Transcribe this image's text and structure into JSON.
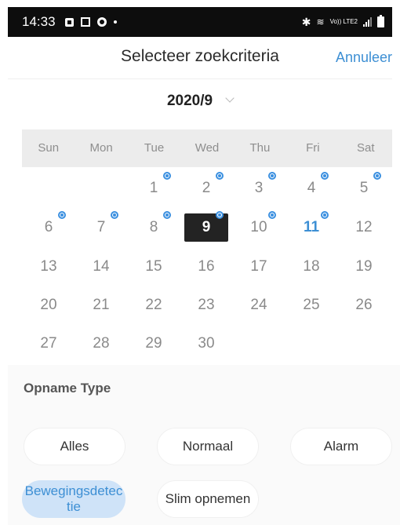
{
  "status_bar": {
    "time": "14:33",
    "lte_label": "Vo)) LTE2"
  },
  "header": {
    "title": "Selecteer zoekcriteria",
    "cancel_label": "Annuleer"
  },
  "calendar": {
    "month_label": "2020/9",
    "weekdays": [
      "Sun",
      "Mon",
      "Tue",
      "Wed",
      "Thu",
      "Fri",
      "Sat"
    ],
    "weeks": [
      [
        "",
        "",
        "1",
        "2",
        "3",
        "4",
        "5"
      ],
      [
        "6",
        "7",
        "8",
        "9",
        "10",
        "11",
        "12"
      ],
      [
        "13",
        "14",
        "15",
        "16",
        "17",
        "18",
        "19"
      ],
      [
        "20",
        "21",
        "22",
        "23",
        "24",
        "25",
        "26"
      ],
      [
        "27",
        "28",
        "29",
        "30",
        "",
        "",
        ""
      ]
    ],
    "selected_day": "9",
    "today": "11",
    "days_with_recordings": [
      "1",
      "2",
      "3",
      "4",
      "5",
      "6",
      "7",
      "8",
      "9",
      "10",
      "11"
    ]
  },
  "recording_type": {
    "title": "Opname Type",
    "options": [
      {
        "label": "Alles",
        "active": false
      },
      {
        "label": "Normaal",
        "active": false
      },
      {
        "label": "Alarm",
        "active": false
      },
      {
        "label": "Bewegingsdetec tie",
        "active": true
      },
      {
        "label": "Slim opnemen",
        "active": false
      }
    ]
  },
  "colors": {
    "accent": "#3d8fd4",
    "selected_bg": "#232323",
    "active_chip_bg": "#cfe3f8"
  }
}
